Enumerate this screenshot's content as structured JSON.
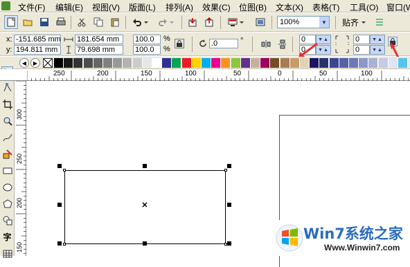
{
  "menubar": {
    "items": [
      "文件(F)",
      "编辑(E)",
      "视图(V)",
      "版面(L)",
      "排列(A)",
      "效果(C)",
      "位图(B)",
      "文本(X)",
      "表格(T)",
      "工具(O)",
      "窗口(W)"
    ]
  },
  "stdbar": {
    "zoom_value": "100%",
    "snap_label": "贴齐"
  },
  "propbar": {
    "x_label": "x:",
    "y_label": "y:",
    "x_value": "-151.685 mm",
    "y_value": "194.811 mm",
    "width_value": "181.654 mm",
    "height_value": "79.698 mm",
    "scale_x": "100.0",
    "scale_y": "100.0",
    "percent_x": "%",
    "percent_y": "%",
    "rotation_value": ".0",
    "degree_symbol": "°",
    "corner_tl": "0",
    "corner_bl": "0",
    "corner_tr": "0",
    "corner_br": "0"
  },
  "palette": {
    "colors": [
      "#000000",
      "#1a1a1a",
      "#333333",
      "#4d4d4d",
      "#666666",
      "#808080",
      "#999999",
      "#b3b3b3",
      "#cccccc",
      "#e6e6e6",
      "#ffffff",
      "#2e3192",
      "#00a651",
      "#ed1c24",
      "#ffd200",
      "#00aeef",
      "#ec008c",
      "#f7941d",
      "#8dc63f",
      "#662d91",
      "#c2b49a",
      "#9e005d",
      "#754c24",
      "#a67c52",
      "#c69c6d",
      "#e0d3b5",
      "#1b1464",
      "#29336b",
      "#3b4691",
      "#5462a6",
      "#6b79b8",
      "#8c97c9",
      "#a9b1d6",
      "#c5cbe4",
      "#e1e4f2",
      "#54c5f0"
    ]
  },
  "hruler": {
    "ticks": [
      "250",
      "200",
      "150",
      "100",
      "50",
      "0",
      "50",
      "100"
    ]
  },
  "vruler": {
    "ticks": [
      "300",
      "250",
      "200",
      "150"
    ]
  },
  "watermark": {
    "title": "Win7系统之家",
    "url": "Www.Winwin7.com"
  }
}
